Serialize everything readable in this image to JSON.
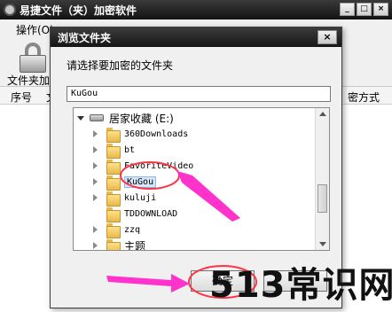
{
  "app": {
    "title": "易捷文件（夹）加密软件",
    "menu": [
      "操作(O)"
    ],
    "toolbar_label": "文件夹加密",
    "columns": [
      "序号",
      "文",
      "密方式"
    ],
    "window_buttons": [
      "_",
      "□",
      "×"
    ]
  },
  "dialog": {
    "title": "浏览文件夹",
    "close_label": "×",
    "prompt": "请选择要加密的文件夹",
    "path_value": "KuGou",
    "tree": [
      {
        "label": "居家收藏 (E:)",
        "icon": "drive-icon",
        "expanded": true
      },
      {
        "label": "360Downloads",
        "icon": "folder-icon"
      },
      {
        "label": "bt",
        "icon": "folder-icon"
      },
      {
        "label": "FavoriteVideo",
        "icon": "folder-icon"
      },
      {
        "label": "KuGou",
        "icon": "folder-icon",
        "selected": true
      },
      {
        "label": "kuluji",
        "icon": "folder-icon"
      },
      {
        "label": "TDDOWNLOAD",
        "icon": "folder-icon"
      },
      {
        "label": "zzq",
        "icon": "folder-icon"
      },
      {
        "label": "主题",
        "icon": "folder-icon"
      }
    ],
    "ok_label": "确定"
  },
  "annotations": {
    "arrow_color": "#ff33cc",
    "circle_color": "#ff3344"
  },
  "watermark": "513常识网"
}
